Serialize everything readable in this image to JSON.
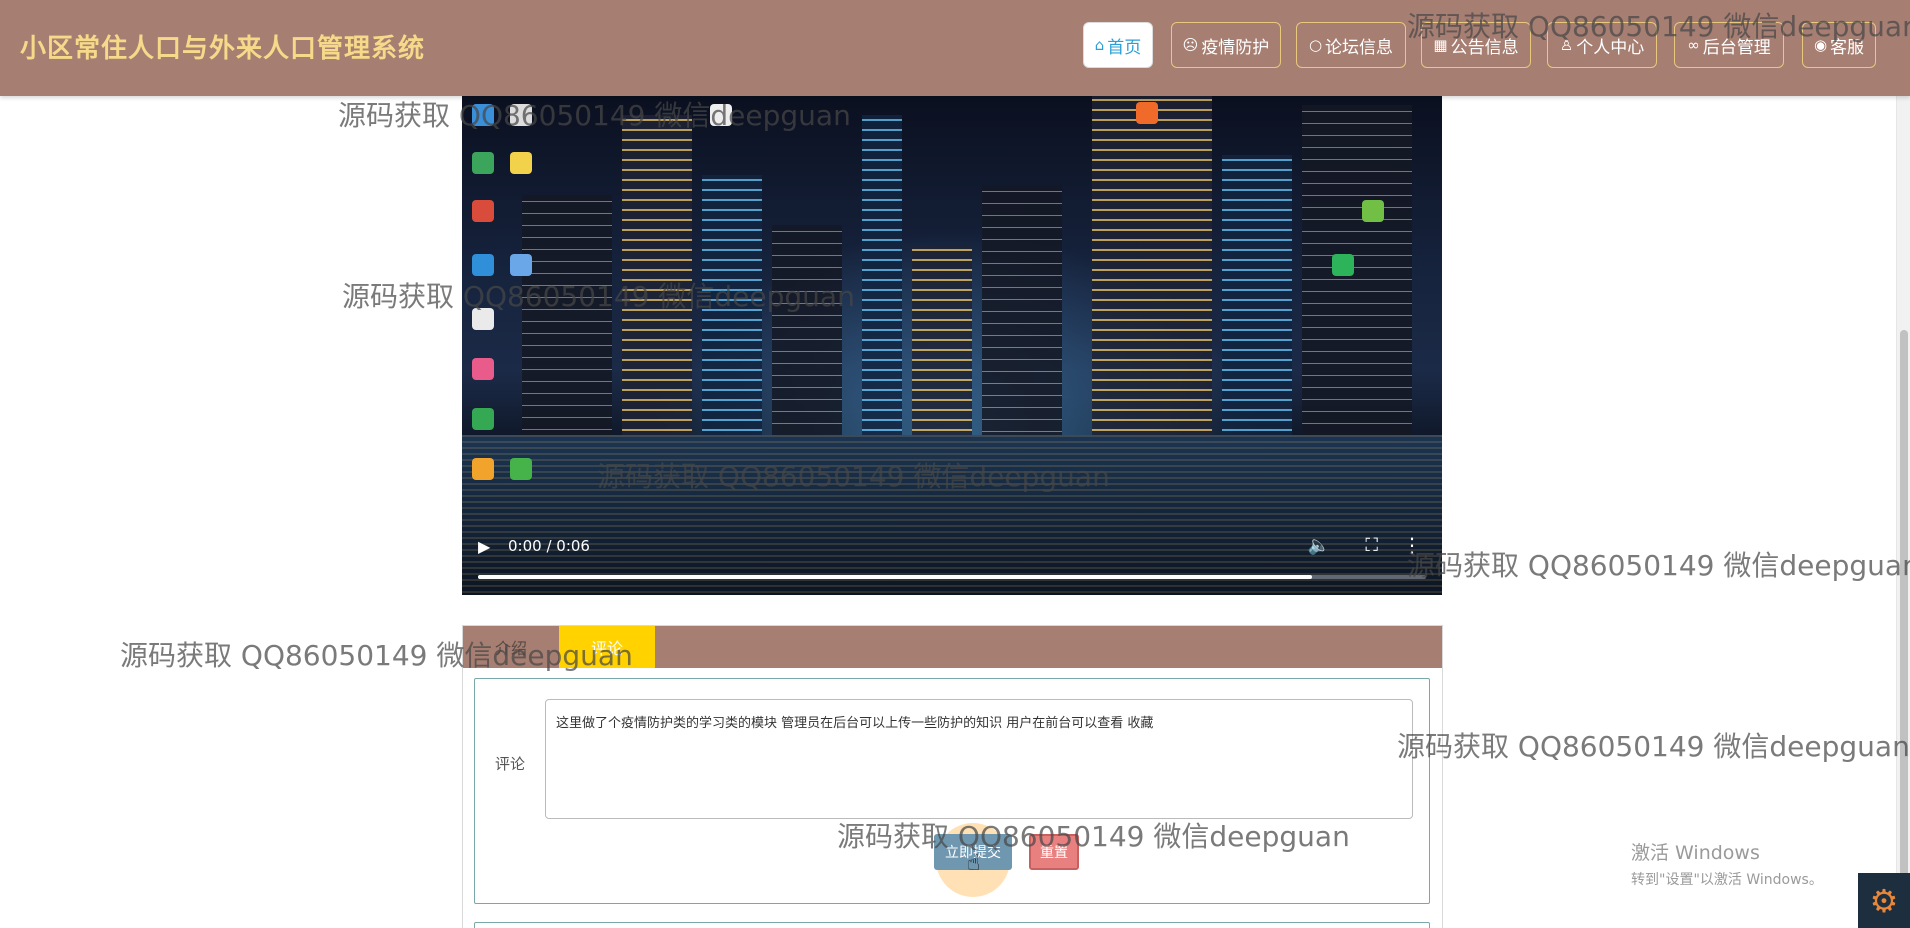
{
  "site": {
    "title": "小区常住人口与外来人口管理系统"
  },
  "nav": [
    {
      "icon": "⌂",
      "icon_name": "home-icon",
      "label": "首页",
      "active": true
    },
    {
      "icon": "☹",
      "icon_name": "epidemic-icon",
      "label": "疫情防护"
    },
    {
      "icon": "○",
      "icon_name": "forum-icon",
      "label": "论坛信息"
    },
    {
      "icon": "▦",
      "icon_name": "notice-icon",
      "label": "公告信息"
    },
    {
      "icon": "♙",
      "icon_name": "user-icon",
      "label": "个人中心"
    },
    {
      "icon": "∞",
      "icon_name": "link-icon",
      "label": "后台管理"
    },
    {
      "icon": "◉",
      "icon_name": "service-icon",
      "label": "客服"
    }
  ],
  "video": {
    "time": "0:00 / 0:06",
    "progress": 0.88
  },
  "tabs": [
    {
      "label": "介绍"
    },
    {
      "label": "评论"
    }
  ],
  "comment_form": {
    "label": "评论",
    "text": "这里做了个疫情防护类的学习类的模块  管理员在后台可以上传一些防护的知识  用户在前台可以查看 收藏",
    "submit": "立即提交",
    "reset": "重置"
  },
  "watermark": "源码获取 QQ86050149 微信deepguan",
  "system": {
    "activate_title": "激活 Windows",
    "activate_sub": "转到\"设置\"以激活 Windows。"
  }
}
